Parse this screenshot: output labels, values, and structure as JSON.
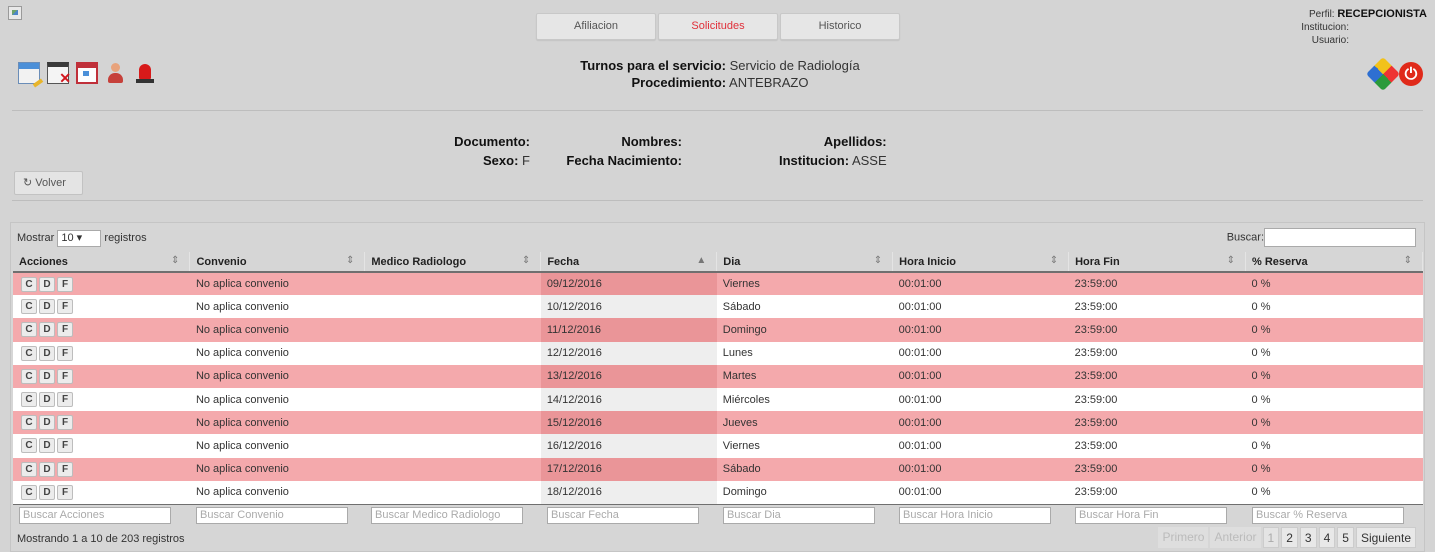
{
  "tabs": [
    {
      "label": "Afiliacion",
      "active": false
    },
    {
      "label": "Solicitudes",
      "active": true
    },
    {
      "label": "Historico",
      "active": false
    }
  ],
  "profile": {
    "perfil_label": "Perfil:",
    "perfil_value": "RECEPCIONISTA",
    "institucion_label": "Institucion:",
    "usuario_label": "Usuario:"
  },
  "toolbar_icons": [
    "id-card-icon",
    "calendar-delete-icon",
    "calendar-icon",
    "user-icon",
    "siren-icon"
  ],
  "right_icons": [
    "modules-icon",
    "power-icon"
  ],
  "service": {
    "turnos_label": "Turnos para el servicio:",
    "turnos_value": "Servicio de Radiología",
    "procedimiento_label": "Procedimiento:",
    "procedimiento_value": "ANTEBRAZO"
  },
  "patient": {
    "documento_label": "Documento:",
    "documento_value": "",
    "sexo_label": "Sexo:",
    "sexo_value": "F",
    "nombres_label": "Nombres:",
    "nombres_value": "",
    "fecha_nac_label": "Fecha Nacimiento:",
    "fecha_nac_value": "",
    "apellidos_label": "Apellidos:",
    "apellidos_value": "",
    "institucion_label": "Institucion:",
    "institucion_value": "ASSE"
  },
  "volver_label": "Volver",
  "table": {
    "length_prefix": "Mostrar",
    "length_value": "10",
    "length_suffix": "registros",
    "search_label": "Buscar:",
    "columns": [
      "Acciones",
      "Convenio",
      "Medico Radiologo",
      "Fecha",
      "Dia",
      "Hora Inicio",
      "Hora Fin",
      "% Reserva"
    ],
    "action_buttons": [
      "C",
      "D",
      "F"
    ],
    "rows": [
      {
        "convenio": "No aplica convenio",
        "medico": "",
        "fecha": "09/12/2016",
        "dia": "Viernes",
        "inicio": "00:01:00",
        "fin": "23:59:00",
        "reserva": "0 %"
      },
      {
        "convenio": "No aplica convenio",
        "medico": "",
        "fecha": "10/12/2016",
        "dia": "Sábado",
        "inicio": "00:01:00",
        "fin": "23:59:00",
        "reserva": "0 %"
      },
      {
        "convenio": "No aplica convenio",
        "medico": "",
        "fecha": "11/12/2016",
        "dia": "Domingo",
        "inicio": "00:01:00",
        "fin": "23:59:00",
        "reserva": "0 %"
      },
      {
        "convenio": "No aplica convenio",
        "medico": "",
        "fecha": "12/12/2016",
        "dia": "Lunes",
        "inicio": "00:01:00",
        "fin": "23:59:00",
        "reserva": "0 %"
      },
      {
        "convenio": "No aplica convenio",
        "medico": "",
        "fecha": "13/12/2016",
        "dia": "Martes",
        "inicio": "00:01:00",
        "fin": "23:59:00",
        "reserva": "0 %"
      },
      {
        "convenio": "No aplica convenio",
        "medico": "",
        "fecha": "14/12/2016",
        "dia": "Miércoles",
        "inicio": "00:01:00",
        "fin": "23:59:00",
        "reserva": "0 %"
      },
      {
        "convenio": "No aplica convenio",
        "medico": "",
        "fecha": "15/12/2016",
        "dia": "Jueves",
        "inicio": "00:01:00",
        "fin": "23:59:00",
        "reserva": "0 %"
      },
      {
        "convenio": "No aplica convenio",
        "medico": "",
        "fecha": "16/12/2016",
        "dia": "Viernes",
        "inicio": "00:01:00",
        "fin": "23:59:00",
        "reserva": "0 %"
      },
      {
        "convenio": "No aplica convenio",
        "medico": "",
        "fecha": "17/12/2016",
        "dia": "Sábado",
        "inicio": "00:01:00",
        "fin": "23:59:00",
        "reserva": "0 %"
      },
      {
        "convenio": "No aplica convenio",
        "medico": "",
        "fecha": "18/12/2016",
        "dia": "Domingo",
        "inicio": "00:01:00",
        "fin": "23:59:00",
        "reserva": "0 %"
      }
    ],
    "filter_placeholders": [
      "Buscar Acciones",
      "Buscar Convenio",
      "Buscar Medico Radiologo",
      "Buscar Fecha",
      "Buscar Dia",
      "Buscar Hora Inicio",
      "Buscar Hora Fin",
      "Buscar % Reserva"
    ],
    "info": "Mostrando 1 a 10 de 203 registros",
    "pager": {
      "first": "Primero",
      "prev": "Anterior",
      "pages": [
        "1",
        "2",
        "3",
        "4",
        "5"
      ],
      "current": "1",
      "next": "Siguiente"
    }
  },
  "colors": {
    "row_highlight": "#f4a9ac",
    "active_tab": "#e0303a"
  }
}
